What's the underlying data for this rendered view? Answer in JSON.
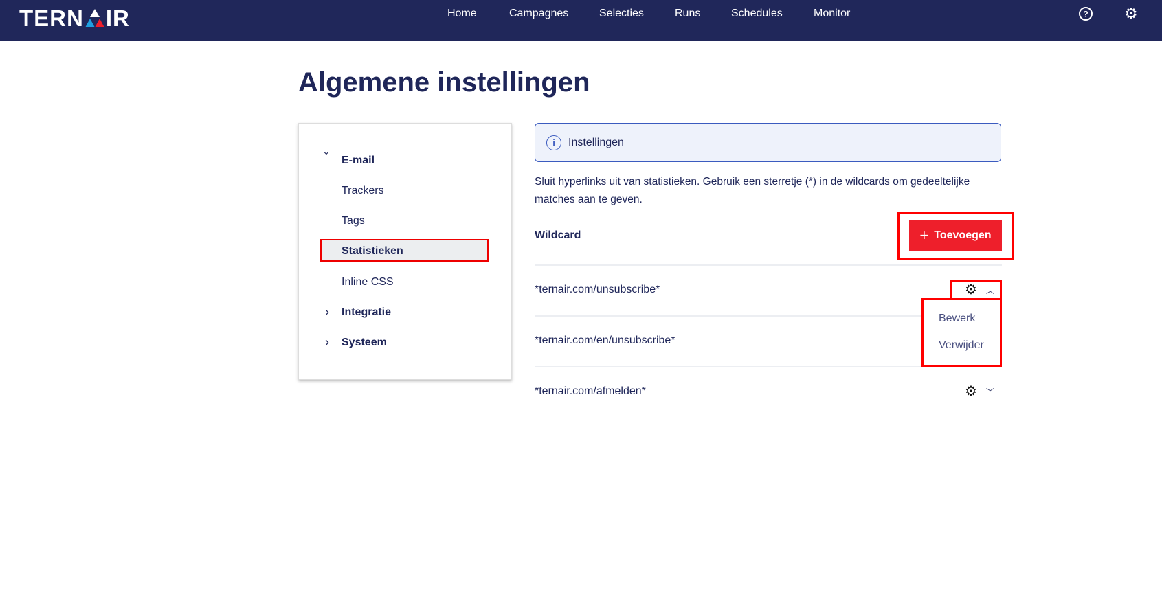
{
  "brand": {
    "name": "TERNAIR"
  },
  "nav": {
    "items": [
      "Home",
      "Campagnes",
      "Selecties",
      "Runs",
      "Schedules",
      "Monitor"
    ]
  },
  "page": {
    "title": "Algemene instellingen"
  },
  "sidebar": {
    "email": "E-mail",
    "trackers": "Trackers",
    "tags": "Tags",
    "statistieken": "Statistieken",
    "inline_css": "Inline CSS",
    "integratie": "Integratie",
    "systeem": "Systeem"
  },
  "main": {
    "info": "Instellingen",
    "description": "Sluit hyperlinks uit van statistieken. Gebruik een sterretje (*) in de wildcards om gedeeltelijke matches aan te geven.",
    "column": "Wildcard",
    "add_label": "Toevoegen",
    "rows": [
      "*ternair.com/unsubscribe*",
      "*ternair.com/en/unsubscribe*",
      "*ternair.com/afmelden*"
    ],
    "menu": {
      "edit": "Bewerk",
      "delete": "Verwijder"
    }
  },
  "colors": {
    "nav": "#20275a",
    "accent": "#ee1f2b",
    "text": "#1f2659"
  }
}
